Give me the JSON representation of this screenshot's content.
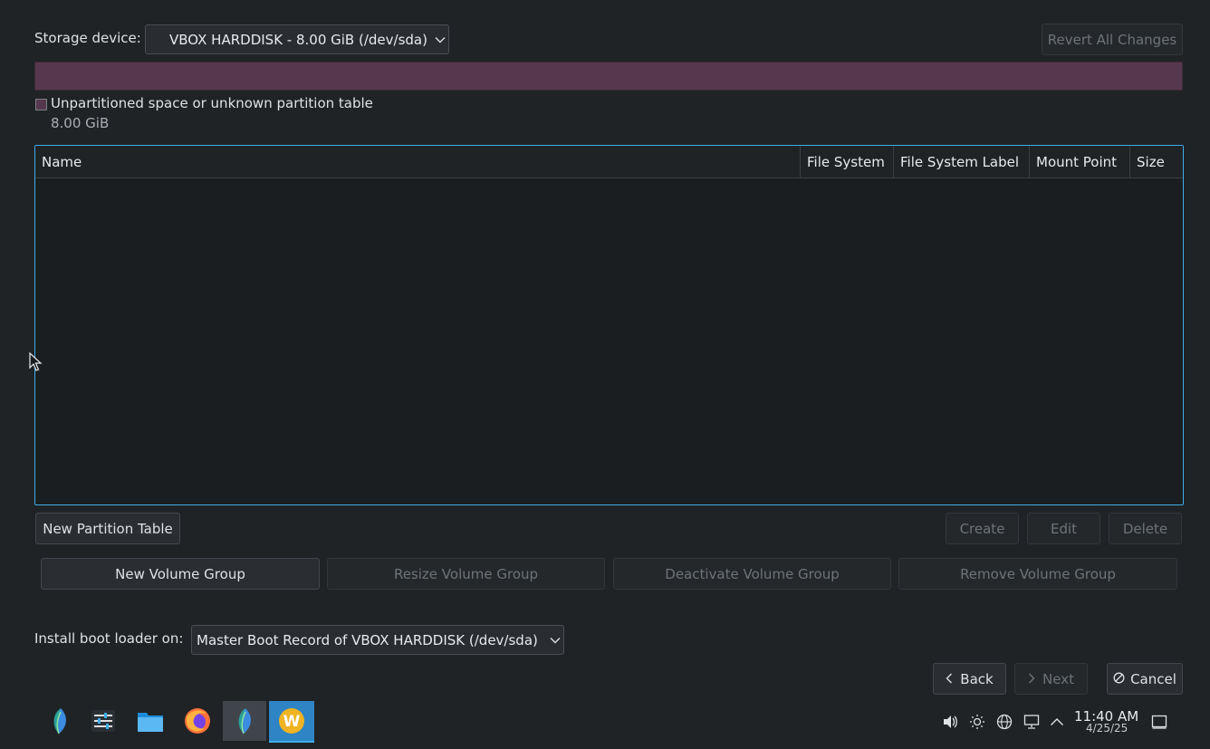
{
  "storage": {
    "label": "Storage device:",
    "selected": "VBOX HARDDISK - 8.00 GiB (/dev/sda)",
    "revert_label": "Revert All Changes"
  },
  "partition_bar": {
    "color": "#56384e"
  },
  "legend": {
    "label": "Unpartitioned space or unknown partition table",
    "size": "8.00 GiB"
  },
  "table": {
    "columns": [
      "Name",
      "File System",
      "File System Label",
      "Mount Point",
      "Size"
    ],
    "rows": []
  },
  "actions": {
    "new_partition_table": "New Partition Table",
    "create": "Create",
    "edit": "Edit",
    "delete": "Delete"
  },
  "volume_group": {
    "new": "New Volume Group",
    "resize": "Resize Volume Group",
    "deactivate": "Deactivate Volume Group",
    "remove": "Remove Volume Group"
  },
  "bootloader": {
    "label": "Install boot loader on:",
    "selected": "Master Boot Record of VBOX HARDDISK (/dev/sda)"
  },
  "nav": {
    "back": "Back",
    "next": "Next",
    "cancel": "Cancel"
  },
  "taskbar": {
    "apps": [
      "calamares-icon",
      "settings-icon",
      "file-manager-icon",
      "firefox-icon",
      "calamares-active-icon",
      "welcome-icon"
    ],
    "time": "11:40 AM",
    "date": "4/25/25"
  },
  "colors": {
    "accent": "#3daee9",
    "background": "#202326"
  }
}
